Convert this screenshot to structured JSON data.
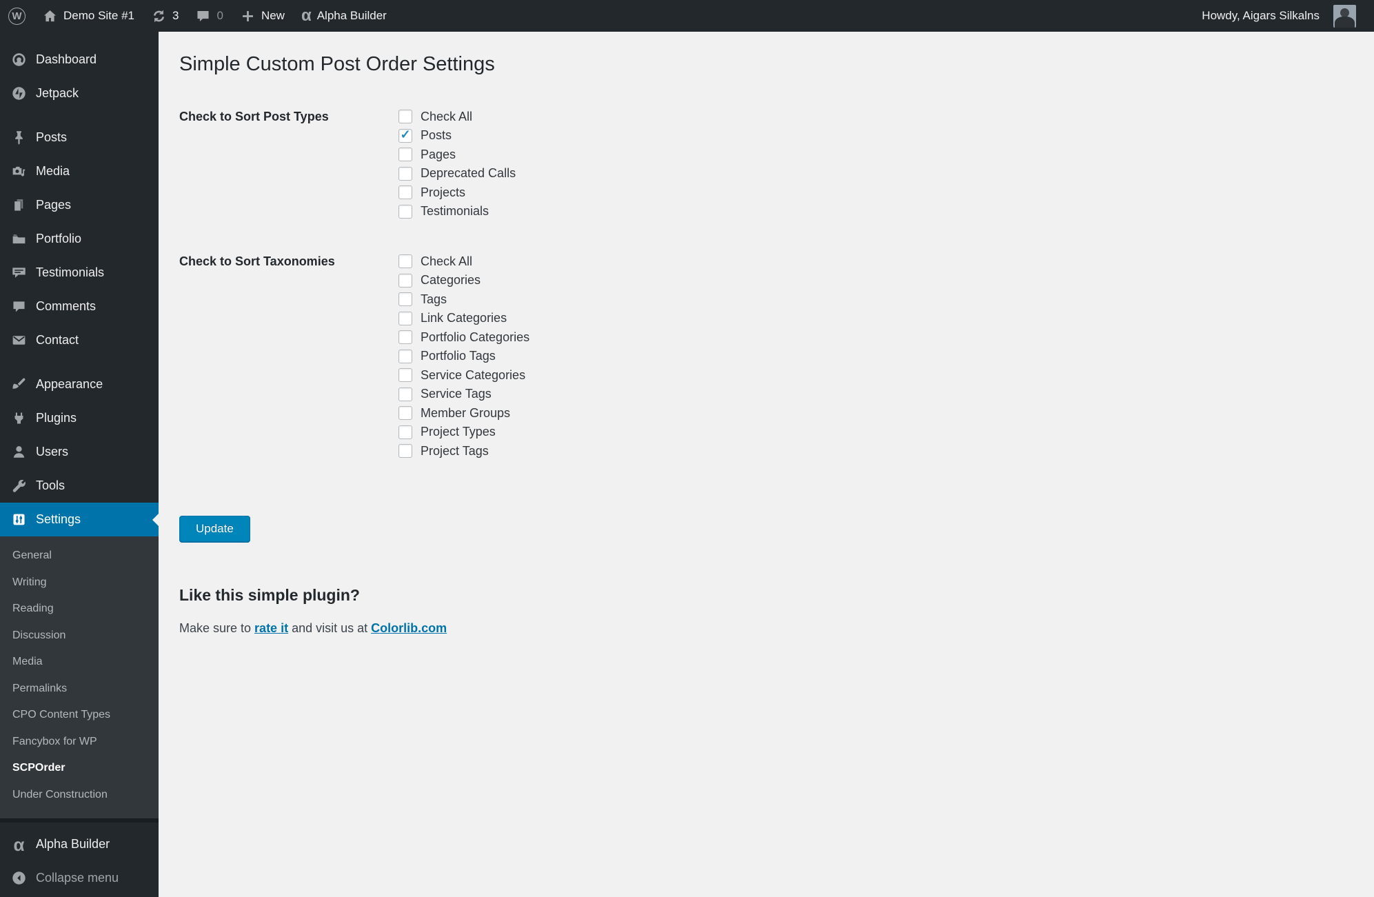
{
  "admin_bar": {
    "wp_logo": "W",
    "site_name": "Demo Site #1",
    "updates_count": "3",
    "comments_count": "0",
    "new_label": "New",
    "builder_label": "Alpha Builder",
    "howdy": "Howdy, Aigars Silkalns"
  },
  "sidebar": {
    "items": [
      {
        "label": "Dashboard",
        "icon": "dashboard-icon"
      },
      {
        "label": "Jetpack",
        "icon": "jetpack-icon"
      },
      {
        "label": "Posts",
        "icon": "pushpin-icon"
      },
      {
        "label": "Media",
        "icon": "camera-icon"
      },
      {
        "label": "Pages",
        "icon": "pages-icon"
      },
      {
        "label": "Portfolio",
        "icon": "folder-icon"
      },
      {
        "label": "Testimonials",
        "icon": "testimonial-bubble-icon"
      },
      {
        "label": "Comments",
        "icon": "comment-bubble-icon"
      },
      {
        "label": "Contact",
        "icon": "envelope-icon"
      },
      {
        "label": "Appearance",
        "icon": "paintbrush-icon"
      },
      {
        "label": "Plugins",
        "icon": "plug-icon"
      },
      {
        "label": "Users",
        "icon": "user-icon"
      },
      {
        "label": "Tools",
        "icon": "wrench-icon"
      },
      {
        "label": "Settings",
        "icon": "sliders-icon",
        "active": true
      }
    ],
    "settings_submenu": [
      {
        "label": "General"
      },
      {
        "label": "Writing"
      },
      {
        "label": "Reading"
      },
      {
        "label": "Discussion"
      },
      {
        "label": "Media"
      },
      {
        "label": "Permalinks"
      },
      {
        "label": "CPO Content Types"
      },
      {
        "label": "Fancybox for WP"
      },
      {
        "label": "SCPOrder",
        "current": true
      },
      {
        "label": "Under Construction"
      }
    ],
    "builder_label": "Alpha Builder",
    "collapse_label": "Collapse menu"
  },
  "main": {
    "title": "Simple Custom Post Order Settings",
    "post_types": {
      "label": "Check to Sort Post Types",
      "items": [
        {
          "label": "Check All",
          "checked": false
        },
        {
          "label": "Posts",
          "checked": true
        },
        {
          "label": "Pages",
          "checked": false
        },
        {
          "label": "Deprecated Calls",
          "checked": false
        },
        {
          "label": "Projects",
          "checked": false
        },
        {
          "label": "Testimonials",
          "checked": false
        }
      ]
    },
    "taxonomies": {
      "label": "Check to Sort Taxonomies",
      "items": [
        {
          "label": "Check All",
          "checked": false
        },
        {
          "label": "Categories",
          "checked": false
        },
        {
          "label": "Tags",
          "checked": false
        },
        {
          "label": "Link Categories",
          "checked": false
        },
        {
          "label": "Portfolio Categories",
          "checked": false
        },
        {
          "label": "Portfolio Tags",
          "checked": false
        },
        {
          "label": "Service Categories",
          "checked": false
        },
        {
          "label": "Service Tags",
          "checked": false
        },
        {
          "label": "Member Groups",
          "checked": false
        },
        {
          "label": "Project Types",
          "checked": false
        },
        {
          "label": "Project Tags",
          "checked": false
        }
      ]
    },
    "update_button": "Update",
    "footer": {
      "heading": "Like this simple plugin?",
      "text_before": "Make sure to ",
      "rate_link": "rate it",
      "text_middle": " and visit us at ",
      "site_link": "Colorlib.com"
    }
  },
  "colors": {
    "admin_bar_bg": "#23282d",
    "submenu_bg": "#32373c",
    "active_accent": "#0073aa",
    "button_bg": "#0085ba",
    "content_bg": "#f1f1f1",
    "link": "#0073aa",
    "checkmark": "#1e8cbe"
  }
}
